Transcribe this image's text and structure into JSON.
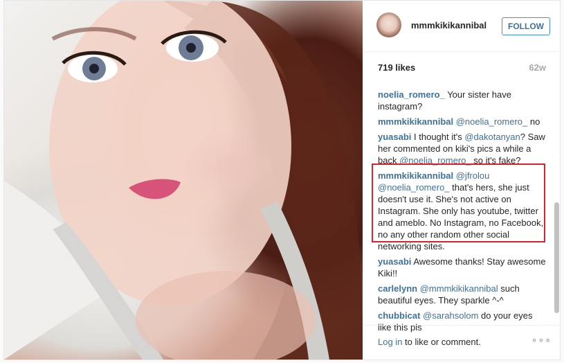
{
  "post": {
    "username": "mmmkikikannibal",
    "follow_label": "FOLLOW",
    "likes": "719 likes",
    "age": "62w"
  },
  "comments": [
    {
      "user": "noelia_romero_",
      "parts": [
        {
          "t": " Your sister have instagram?"
        }
      ]
    },
    {
      "user": "mmmkikikannibal",
      "parts": [
        {
          "t": " "
        },
        {
          "m": "@noelia_romero_"
        },
        {
          "t": " no"
        }
      ]
    },
    {
      "user": "yuasabi",
      "parts": [
        {
          "t": " I thought it's "
        },
        {
          "m": "@dakotanyan"
        },
        {
          "t": "? Saw her commented on kiki's pics a while a back "
        },
        {
          "m": "@noelia_romero_"
        },
        {
          "t": " so it's fake?"
        }
      ]
    },
    {
      "user": "mmmkikikannibal",
      "parts": [
        {
          "t": " "
        },
        {
          "m": "@jfrolou"
        },
        {
          "t": " "
        },
        {
          "m": "@noelia_romero_"
        },
        {
          "t": " that's hers, she just doesn't use it. She's not active on Instagram. She only has youtube, twitter and ameblo. No Instagram, no Facebook, no any other random other social networking sites."
        }
      ],
      "highlight": true
    },
    {
      "user": "yuasabi",
      "parts": [
        {
          "t": " Awesome thanks! Stay awesome Kiki!!"
        }
      ]
    },
    {
      "user": "carlelynn",
      "parts": [
        {
          "t": " "
        },
        {
          "m": "@mmmkikikannibal"
        },
        {
          "t": " such beautiful eyes. They sparkle ^-^"
        }
      ]
    },
    {
      "user": "chubbicat",
      "parts": [
        {
          "t": " "
        },
        {
          "m": "@sarahsolom"
        },
        {
          "t": " do your eyes like this pls"
        }
      ]
    }
  ],
  "footer": {
    "login_link": "Log in",
    "login_rest": " to like or comment.",
    "more": "∘∘∘"
  },
  "colors": {
    "link": "#3f729b",
    "highlight_border": "#d9232a",
    "follow_border": "#4090db"
  },
  "icons": [
    "more-options-icon"
  ]
}
